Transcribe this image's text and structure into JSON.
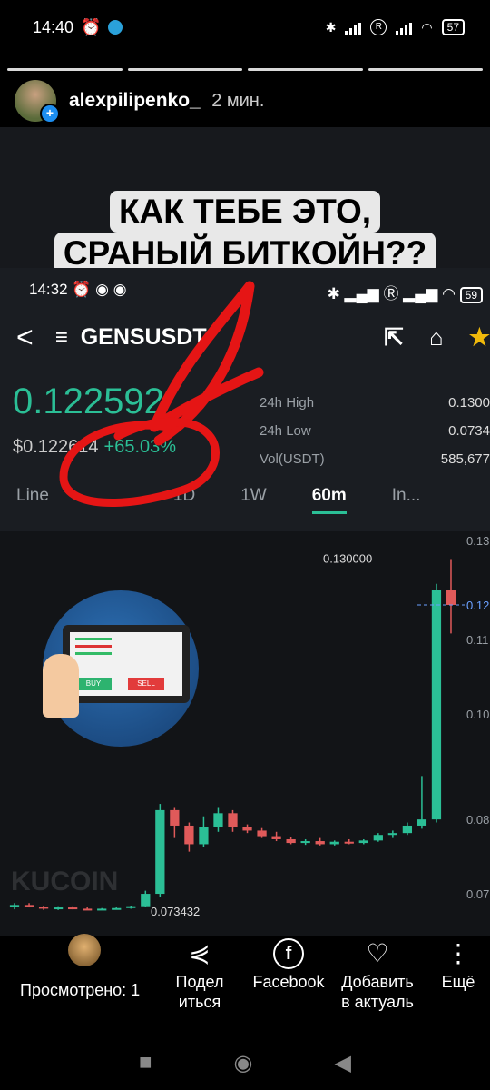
{
  "status": {
    "time": "14:40",
    "battery": "57"
  },
  "story": {
    "username": "alexpilipenko_",
    "age": "2 мин.",
    "caption_line1": "КАК ТЕБЕ ЭТО,",
    "caption_line2": "СРАНЫЙ БИТКОЙН??"
  },
  "app": {
    "time": "14:32",
    "battery": "59",
    "pair": "GENSUSDT",
    "price": "0.122592",
    "fiat": "$0.122614",
    "change": "+65.03%",
    "stats": [
      {
        "label": "24h High",
        "value": "0.1300"
      },
      {
        "label": "24h Low",
        "value": "0.0734"
      },
      {
        "label": "Vol(USDT)",
        "value": "585,677"
      }
    ],
    "timeframes": [
      "Line",
      "15m",
      "1D",
      "1W",
      "60m",
      "In..."
    ],
    "high_label": "0.130000",
    "low_label": "0.073432",
    "axis": [
      "0.13",
      "0.12",
      "0.11",
      "0.10",
      "0.08",
      "0.07"
    ],
    "watermark": "KUCOIN",
    "ill_buy": "BUY",
    "ill_sell": "SELL"
  },
  "actions": {
    "viewed": "Просмотрено: 1",
    "share_1": "Подел",
    "share_2": "иться",
    "facebook": "Facebook",
    "add_1": "Добавить",
    "add_2": "в актуаль",
    "more": "Ещё"
  },
  "chart_data": {
    "type": "candlestick",
    "title": "GENSUSDT 60m",
    "candles": [
      [
        0.074,
        0.0745,
        0.0735,
        0.0742
      ],
      [
        0.0742,
        0.0745,
        0.0738,
        0.0739
      ],
      [
        0.0739,
        0.0741,
        0.0734,
        0.0736
      ],
      [
        0.0736,
        0.074,
        0.0734,
        0.0738
      ],
      [
        0.0738,
        0.074,
        0.0735,
        0.0736
      ],
      [
        0.0736,
        0.0738,
        0.0734,
        0.0735
      ],
      [
        0.0735,
        0.0737,
        0.0734,
        0.0736
      ],
      [
        0.0736,
        0.0738,
        0.0735,
        0.0737
      ],
      [
        0.0737,
        0.0741,
        0.0736,
        0.074
      ],
      [
        0.074,
        0.0765,
        0.0739,
        0.076
      ],
      [
        0.076,
        0.0905,
        0.0755,
        0.0895
      ],
      [
        0.0895,
        0.09,
        0.085,
        0.087
      ],
      [
        0.087,
        0.0875,
        0.0828,
        0.084
      ],
      [
        0.084,
        0.0885,
        0.0835,
        0.0868
      ],
      [
        0.0868,
        0.09,
        0.086,
        0.089
      ],
      [
        0.089,
        0.0895,
        0.086,
        0.0868
      ],
      [
        0.0868,
        0.0872,
        0.0858,
        0.0862
      ],
      [
        0.0862,
        0.0866,
        0.085,
        0.0853
      ],
      [
        0.0853,
        0.086,
        0.0845,
        0.0848
      ],
      [
        0.0848,
        0.0852,
        0.084,
        0.0842
      ],
      [
        0.0842,
        0.0848,
        0.0839,
        0.0845
      ],
      [
        0.0845,
        0.085,
        0.0838,
        0.084
      ],
      [
        0.084,
        0.0846,
        0.0838,
        0.0844
      ],
      [
        0.0844,
        0.0848,
        0.084,
        0.0842
      ],
      [
        0.0842,
        0.0848,
        0.084,
        0.0846
      ],
      [
        0.0846,
        0.0858,
        0.0844,
        0.0855
      ],
      [
        0.0855,
        0.0862,
        0.085,
        0.0858
      ],
      [
        0.0858,
        0.0875,
        0.0855,
        0.087
      ],
      [
        0.087,
        0.095,
        0.0865,
        0.088
      ],
      [
        0.088,
        0.126,
        0.0875,
        0.125
      ],
      [
        0.125,
        0.13,
        0.118,
        0.1226
      ]
    ],
    "ylim": [
      0.07,
      0.133
    ],
    "annotations": [
      "0.130000",
      "0.073432"
    ]
  }
}
